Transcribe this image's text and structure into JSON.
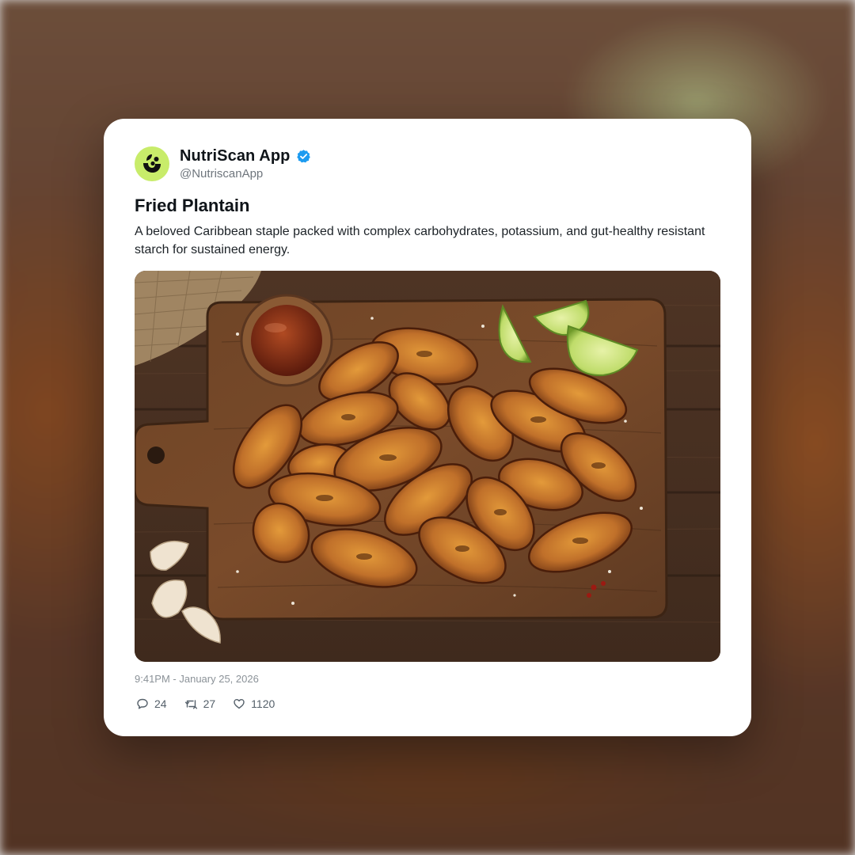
{
  "post": {
    "account_name": "NutriScan App",
    "handle": "@NutriscanApp",
    "verified": true,
    "title": "Fried Plantain",
    "body": "A beloved Caribbean staple packed with complex carbohydrates, potassium, and gut-healthy resistant starch for sustained energy.",
    "timestamp": "9:41PM - January 25, 2026",
    "replies": "24",
    "reposts": "27",
    "likes": "1120",
    "image_alt": "Fried plantain slices on a wooden cutting board with lime wedges, dipping sauce and garlic cloves"
  },
  "icons": {
    "avatar": "nutriscan-logo-icon",
    "verified": "verified-badge-icon",
    "reply": "reply-icon",
    "repost": "repost-icon",
    "like": "heart-icon"
  },
  "colors": {
    "avatar_bg": "#c8ec6a",
    "verified_blue": "#1d9bf0",
    "text_primary": "#0f1419",
    "text_secondary": "#6f767d"
  }
}
